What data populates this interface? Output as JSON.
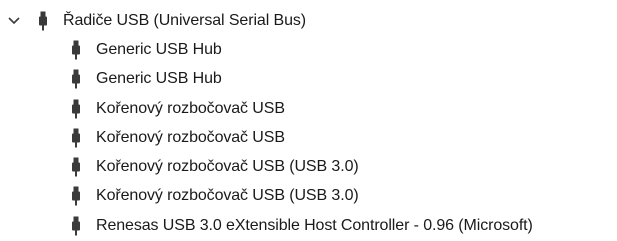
{
  "tree": {
    "category": {
      "label": "Řadiče USB (Universal Serial Bus)",
      "expander_icon": "chevron-down-icon",
      "icon": "usb-connector-icon"
    },
    "children": [
      {
        "label": "Generic USB Hub",
        "icon": "usb-connector-icon"
      },
      {
        "label": "Generic USB Hub",
        "icon": "usb-connector-icon"
      },
      {
        "label": "Kořenový rozbočovač USB",
        "icon": "usb-connector-icon"
      },
      {
        "label": "Kořenový rozbočovač USB",
        "icon": "usb-connector-icon"
      },
      {
        "label": "Kořenový rozbočovač USB (USB 3.0)",
        "icon": "usb-connector-icon"
      },
      {
        "label": "Kořenový rozbočovač USB (USB 3.0)",
        "icon": "usb-connector-icon"
      },
      {
        "label": "Renesas USB 3.0 eXtensible Host Controller - 0.96 (Microsoft)",
        "icon": "usb-connector-icon"
      }
    ]
  },
  "colors": {
    "text": "#1a1a1a",
    "icon": "#3a3a3a",
    "background": "#ffffff"
  }
}
